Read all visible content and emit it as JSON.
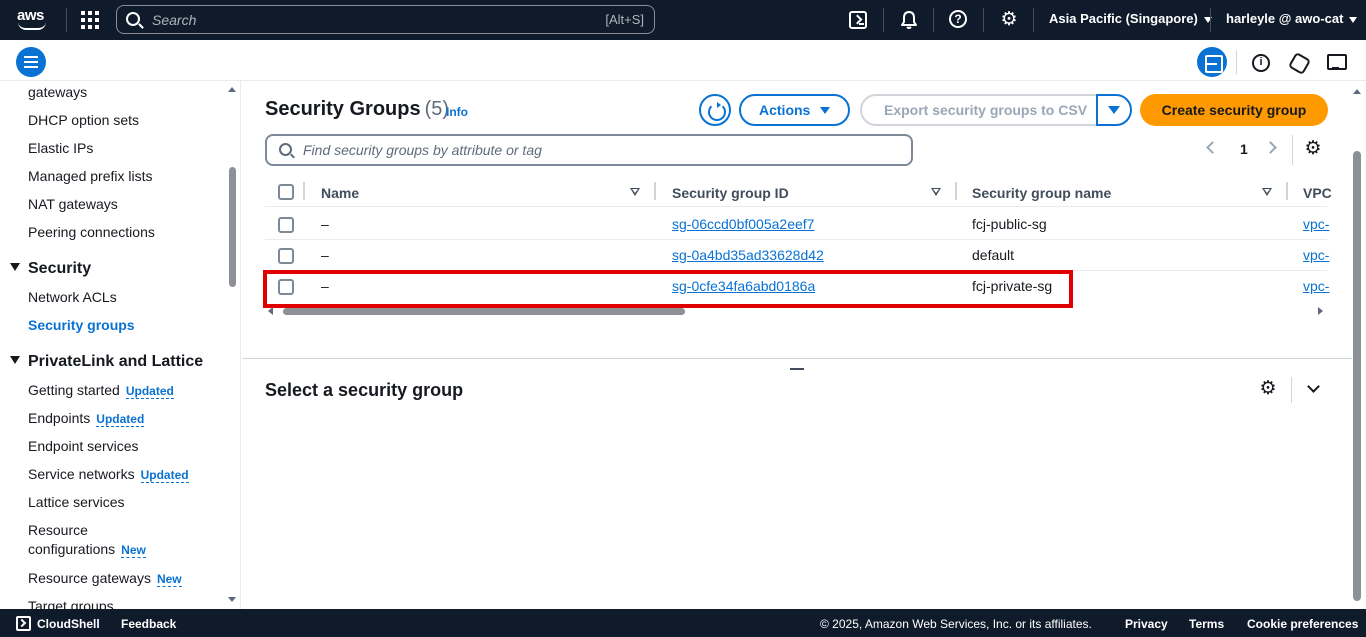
{
  "topnav": {
    "search_placeholder": "Search",
    "search_shortcut": "[Alt+S]",
    "region": "Asia Pacific (Singapore)",
    "user": "harleyle @ awo-cat"
  },
  "sidebar": {
    "items_top": [
      "gateways",
      "DHCP option sets",
      "Elastic IPs",
      "Managed prefix lists",
      "NAT gateways",
      "Peering connections"
    ],
    "security_heading": "Security",
    "security_items": [
      "Network ACLs",
      "Security groups"
    ],
    "privatelink_heading": "PrivateLink and Lattice",
    "privatelink_items": [
      {
        "label": "Getting started",
        "badge": "Updated"
      },
      {
        "label": "Endpoints",
        "badge": "Updated"
      },
      {
        "label": "Endpoint services",
        "badge": ""
      },
      {
        "label": "Service networks",
        "badge": "Updated"
      },
      {
        "label": "Lattice services",
        "badge": ""
      },
      {
        "label": "Resource",
        "label2": "configurations",
        "badge": "New"
      },
      {
        "label": "Resource gateways",
        "badge": "New"
      },
      {
        "label": "Target groups",
        "badge": ""
      }
    ]
  },
  "main": {
    "title": "Security Groups",
    "count": "(5)",
    "info_label": "Info",
    "actions_label": "Actions",
    "export_label": "Export security groups to CSV",
    "create_label": "Create security group",
    "filter_placeholder": "Find security groups by attribute or tag",
    "current_page": "1",
    "table": {
      "headers": [
        "Name",
        "Security group ID",
        "Security group name",
        "VPC"
      ],
      "rows": [
        {
          "name": "–",
          "id": "sg-06ccd0bf005a2eef7",
          "group_name": "fcj-public-sg",
          "vpc": "vpc-"
        },
        {
          "name": "–",
          "id": "sg-0a4bd35ad33628d42",
          "group_name": "default",
          "vpc": "vpc-"
        },
        {
          "name": "–",
          "id": "sg-0cfe34fa6abd0186a",
          "group_name": "fcj-private-sg",
          "vpc": "vpc-"
        }
      ]
    },
    "detail_title": "Select a security group"
  },
  "footer": {
    "cloudshell": "CloudShell",
    "feedback": "Feedback",
    "copyright": "© 2025, Amazon Web Services, Inc. or its affiliates.",
    "privacy": "Privacy",
    "terms": "Terms",
    "cookies": "Cookie preferences"
  },
  "colors": {
    "nav_bg": "#0f1b2a",
    "link": "#0972d3",
    "primary_button": "#ff9900",
    "highlight": "#e00000"
  }
}
